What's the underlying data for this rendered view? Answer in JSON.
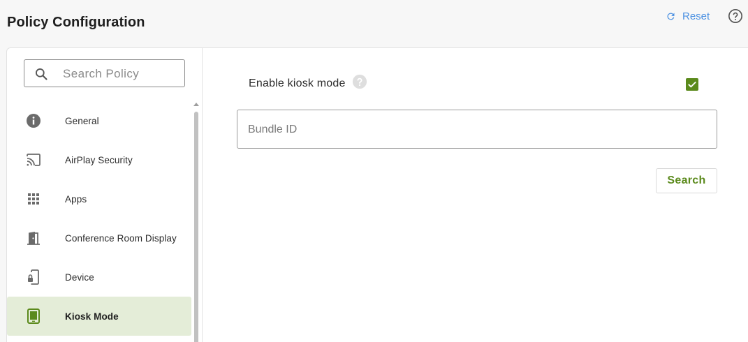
{
  "header": {
    "title": "Policy Configuration",
    "reset_label": "Reset",
    "reset_icon": "refresh-icon",
    "help_icon": "help-circle-icon"
  },
  "sidebar": {
    "search": {
      "placeholder": "Search Policy",
      "value": "",
      "icon": "search-icon"
    },
    "items": [
      {
        "label": "General",
        "icon": "info-icon"
      },
      {
        "label": "AirPlay Security",
        "icon": "cast-icon"
      },
      {
        "label": "Apps",
        "icon": "grid-icon"
      },
      {
        "label": "Conference Room Display",
        "icon": "door-icon"
      },
      {
        "label": "Device",
        "icon": "device-lock-icon"
      },
      {
        "label": "Kiosk Mode",
        "icon": "tablet-icon",
        "active": true
      }
    ]
  },
  "main": {
    "kiosk_label": "Enable kiosk mode",
    "kiosk_enabled": true,
    "bundle_placeholder": "Bundle ID",
    "bundle_value": "",
    "search_label": "Search"
  },
  "colors": {
    "accent_green": "#5b8a1c",
    "active_bg": "#e4edd8",
    "link_blue": "#4a90e2"
  }
}
